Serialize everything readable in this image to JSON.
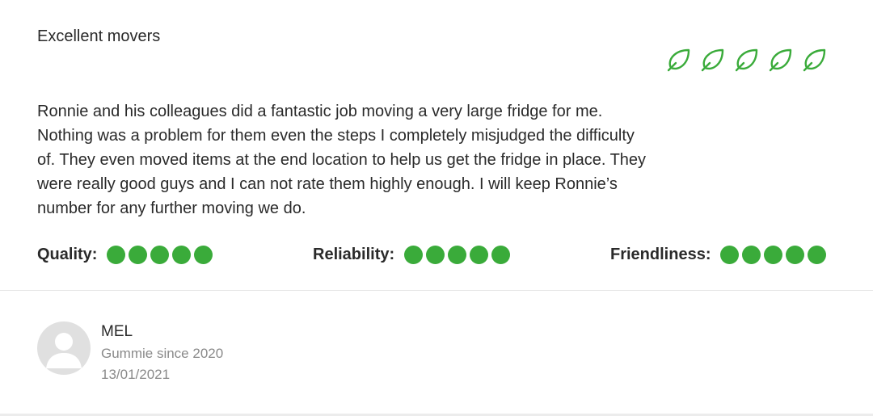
{
  "review": {
    "title": "Excellent movers",
    "leaf_rating": {
      "value": 5,
      "max": 5,
      "icon": "leaf-icon",
      "color": "#3aab3a"
    },
    "body": "Ronnie and his colleagues did a fantastic job moving a very large fridge for me. Nothing was a problem for them even the steps I completely misjudged the difficulty of. They even moved items at the end location to help us get the fridge in place. They were really good guys and I can not rate them highly enough. I will keep Ronnie’s number for any further moving we do.",
    "scores": [
      {
        "label": "Quality:",
        "value": 5,
        "max": 5
      },
      {
        "label": "Reliability:",
        "value": 5,
        "max": 5
      },
      {
        "label": "Friendliness:",
        "value": 5,
        "max": 5
      }
    ],
    "dot_color": "#3aab3a"
  },
  "reviewer": {
    "name": "MEL",
    "member_since": "Gummie since 2020",
    "date": "13/01/2021",
    "avatar_icon": "default-avatar-icon"
  }
}
